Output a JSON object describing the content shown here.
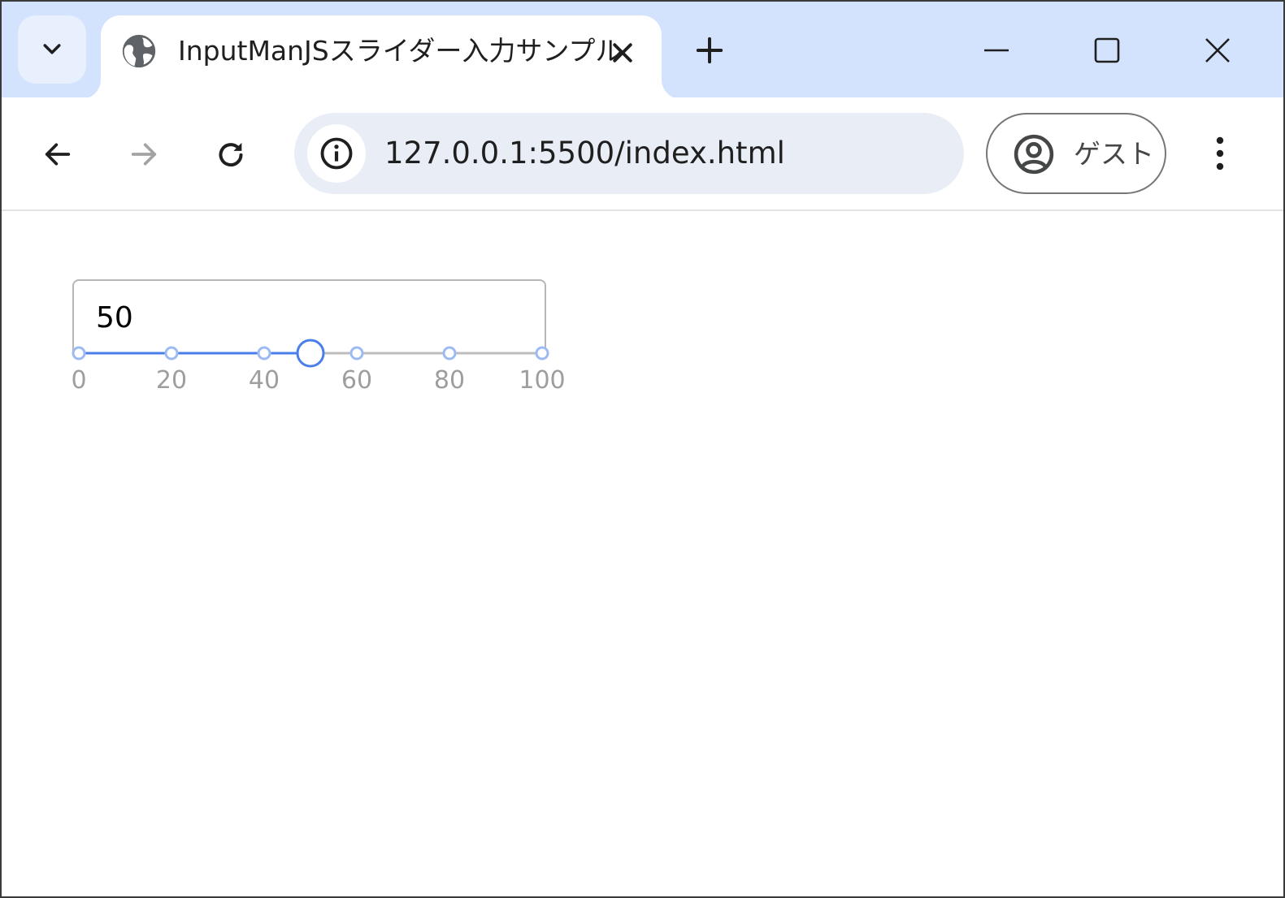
{
  "browser": {
    "tab": {
      "title": "InputManJSスライダー入力サンプル"
    },
    "address_bar": {
      "url": "127.0.0.1:5500/index.html"
    },
    "profile": {
      "label": "ゲスト"
    },
    "icons": {
      "tab_search": "chevron-down-icon",
      "favicon": "globe-icon",
      "tab_close": "close-icon",
      "new_tab": "plus-icon",
      "minimize": "minimize-icon",
      "maximize": "maximize-icon",
      "close_window": "close-icon",
      "back": "arrow-left-icon",
      "forward": "arrow-right-icon",
      "reload": "reload-icon",
      "site_info": "info-icon",
      "profile": "account-circle-icon",
      "menu": "more-vert-icon"
    },
    "colors": {
      "tabstrip": "#d3e3fd",
      "omnibox": "#e9eef6"
    }
  },
  "slider": {
    "value": "50",
    "numeric_value": 50,
    "min": 0,
    "max": 100,
    "ticks": [
      "0",
      "20",
      "40",
      "60",
      "80",
      "100"
    ],
    "tick_values": [
      0,
      20,
      40,
      60,
      80,
      100
    ],
    "colors": {
      "active": "#4a7ee8",
      "inactive": "#bdbdbd",
      "tick_fill": "#ffffff",
      "tick_stroke": "#9cbaf3",
      "label": "#9e9e9e"
    }
  }
}
